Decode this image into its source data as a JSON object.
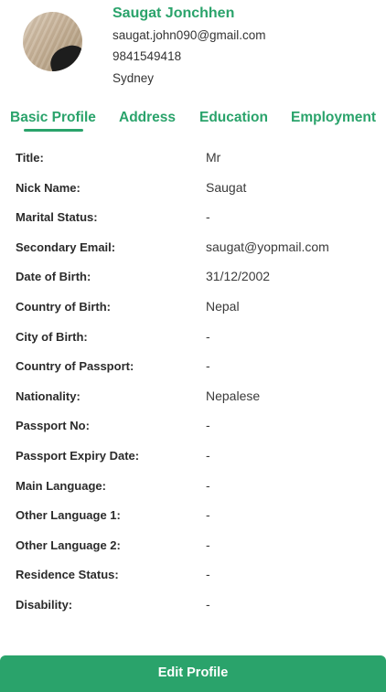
{
  "user": {
    "name": "Saugat Jonchhen",
    "email": "saugat.john090@gmail.com",
    "phone": "9841549418",
    "city": "Sydney"
  },
  "tabs": [
    {
      "label": "Basic Profile",
      "active": true
    },
    {
      "label": "Address",
      "active": false
    },
    {
      "label": "Education",
      "active": false
    },
    {
      "label": "Employment",
      "active": false
    }
  ],
  "fields": [
    {
      "label": "Title:",
      "value": "Mr"
    },
    {
      "label": "Nick Name:",
      "value": "Saugat"
    },
    {
      "label": "Marital Status:",
      "value": "-"
    },
    {
      "label": "Secondary Email:",
      "value": "saugat@yopmail.com"
    },
    {
      "label": "Date of Birth:",
      "value": "31/12/2002"
    },
    {
      "label": "Country of Birth:",
      "value": "Nepal"
    },
    {
      "label": "City of Birth:",
      "value": "-"
    },
    {
      "label": "Country of Passport:",
      "value": "-"
    },
    {
      "label": "Nationality:",
      "value": "Nepalese"
    },
    {
      "label": "Passport No:",
      "value": "-"
    },
    {
      "label": "Passport Expiry Date:",
      "value": "-"
    },
    {
      "label": "Main Language:",
      "value": "-"
    },
    {
      "label": "Other Language 1:",
      "value": "-"
    },
    {
      "label": "Other Language 2:",
      "value": "-"
    },
    {
      "label": "Residence Status:",
      "value": "-"
    },
    {
      "label": "Disability:",
      "value": "-"
    }
  ],
  "actions": {
    "edit_label": "Edit Profile"
  },
  "colors": {
    "accent": "#2aa36b",
    "label_text": "#2b2b2b",
    "value_text": "#3a3a3a"
  }
}
